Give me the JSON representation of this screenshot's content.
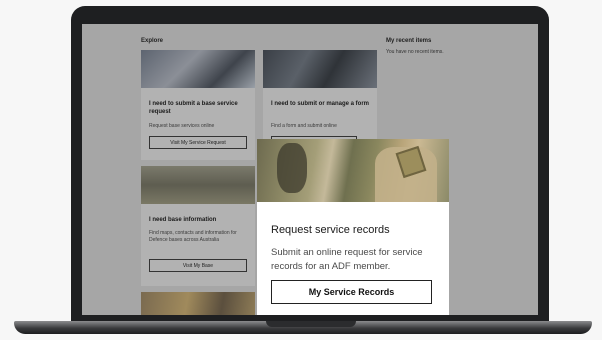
{
  "explore": {
    "heading": "Explore",
    "cards": [
      {
        "title": "I need to submit a base service request",
        "description": "Request base services online",
        "button": "Visit My Service Request"
      },
      {
        "title": "I need to submit or manage a form",
        "description": "Find a form and submit online",
        "button": ""
      },
      {
        "title": "I need base information",
        "description": "Find maps, contacts and information for Defence bases across Australia",
        "button": "Visit My Base"
      }
    ]
  },
  "recent": {
    "heading": "My recent items",
    "empty_text": "You have no recent items."
  },
  "highlight": {
    "title": "Request service records",
    "description": "Submit an online request for service records for an ADF member.",
    "button": "My Service Records"
  }
}
